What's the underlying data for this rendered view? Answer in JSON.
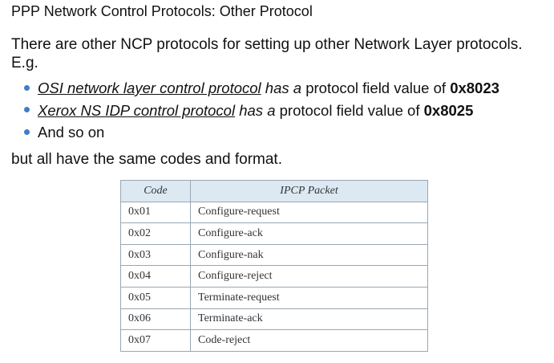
{
  "title": "PPP Network Control Protocols: Other Protocol",
  "intro": "There are other NCP protocols for setting up other Network Layer protocols. E.g.",
  "bullets": [
    {
      "name": "OSI network layer control protocol",
      "mid": "has a",
      "rest": "protocol field value of",
      "value": "0x8023"
    },
    {
      "name": "Xerox NS IDP control protocol",
      "mid": "has a",
      "rest": "protocol field value of",
      "value": "0x8025"
    },
    {
      "text": "And so on"
    }
  ],
  "conclusion": "but all have the same codes and format.",
  "table": {
    "headers": [
      "Code",
      "IPCP Packet"
    ],
    "rows": [
      [
        "0x01",
        "Configure-request"
      ],
      [
        "0x02",
        "Configure-ack"
      ],
      [
        "0x03",
        "Configure-nak"
      ],
      [
        "0x04",
        "Configure-reject"
      ],
      [
        "0x05",
        "Terminate-request"
      ],
      [
        "0x06",
        "Terminate-ack"
      ],
      [
        "0x07",
        "Code-reject"
      ]
    ]
  },
  "colors": {
    "bullet": "#3d7fc4",
    "table_header": "#dce9f3"
  }
}
